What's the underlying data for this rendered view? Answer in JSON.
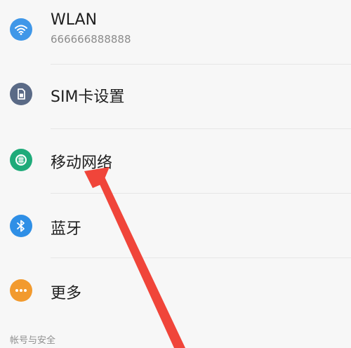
{
  "settings": {
    "wlan": {
      "label": "WLAN",
      "subtitle": "666666888888",
      "icon": "wifi-icon",
      "color": "#3f97e8"
    },
    "sim": {
      "label": "SIM卡设置",
      "icon": "sim-card-icon",
      "color": "#5a6a86"
    },
    "mobile_network": {
      "label": "移动网络",
      "icon": "globe-icon",
      "color": "#1fab7a"
    },
    "bluetooth": {
      "label": "蓝牙",
      "icon": "bluetooth-icon",
      "color": "#2f8fe6"
    },
    "more": {
      "label": "更多",
      "icon": "more-icon",
      "color": "#f29a2e"
    }
  },
  "section_header": "帐号与安全",
  "annotation": {
    "arrow_color": "#f0453a"
  }
}
